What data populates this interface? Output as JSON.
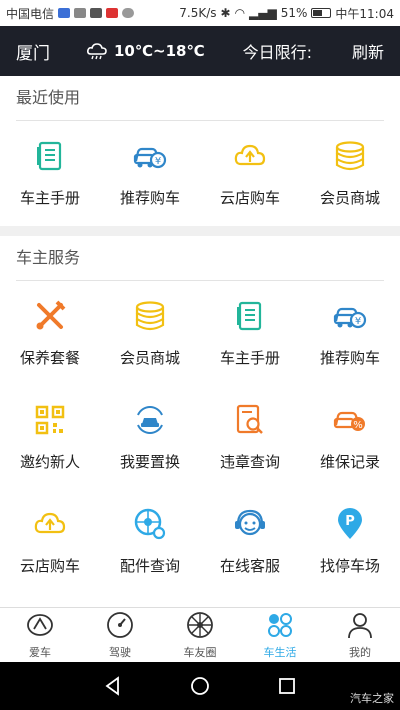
{
  "status": {
    "carrier": "中国电信",
    "speed": "7.5K/s",
    "battery": "51%",
    "time": "中午11:04"
  },
  "header": {
    "city": "厦门",
    "weather": "10℃~18℃",
    "limit": "今日限行:",
    "refresh": "刷新"
  },
  "recent": {
    "title": "最近使用",
    "items": [
      {
        "label": "车主手册",
        "icon": "manual-icon"
      },
      {
        "label": "推荐购车",
        "icon": "car-yen-icon"
      },
      {
        "label": "云店购车",
        "icon": "cloud-upload-icon"
      },
      {
        "label": "会员商城",
        "icon": "coins-icon"
      }
    ]
  },
  "services": {
    "title": "车主服务",
    "items": [
      {
        "label": "保养套餐",
        "icon": "wrench-screwdriver-icon"
      },
      {
        "label": "会员商城",
        "icon": "coins-icon"
      },
      {
        "label": "车主手册",
        "icon": "manual-icon"
      },
      {
        "label": "推荐购车",
        "icon": "car-yen-icon"
      },
      {
        "label": "邀约新人",
        "icon": "qr-code-icon"
      },
      {
        "label": "我要置换",
        "icon": "car-swap-icon"
      },
      {
        "label": "违章查询",
        "icon": "ticket-search-icon"
      },
      {
        "label": "维保记录",
        "icon": "car-percent-icon"
      },
      {
        "label": "云店购车",
        "icon": "cloud-upload-icon"
      },
      {
        "label": "配件查询",
        "icon": "wheel-search-icon"
      },
      {
        "label": "在线客服",
        "icon": "headset-icon"
      },
      {
        "label": "找停车场",
        "icon": "parking-pin-icon"
      }
    ]
  },
  "tabs": [
    {
      "label": "爱车",
      "icon": "car-logo-icon",
      "active": false
    },
    {
      "label": "驾驶",
      "icon": "speedometer-icon",
      "active": false
    },
    {
      "label": "车友圈",
      "icon": "wheel-icon",
      "active": false
    },
    {
      "label": "车生活",
      "icon": "four-dots-icon",
      "active": true
    },
    {
      "label": "我的",
      "icon": "person-icon",
      "active": false
    }
  ],
  "watermark": "汽车之家",
  "colors": {
    "header_bg": "#1d2029",
    "accent": "#2ea9e6",
    "green": "#22b59a",
    "blue": "#2f86c9",
    "yellow": "#f2c012",
    "orange": "#f07a2a"
  }
}
